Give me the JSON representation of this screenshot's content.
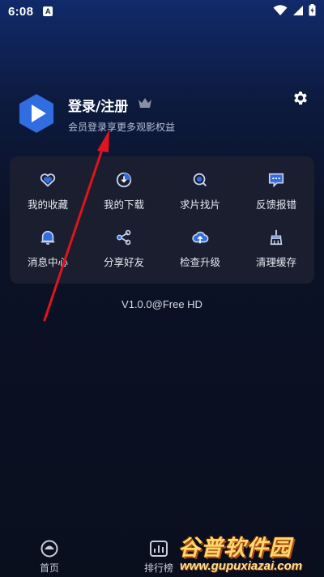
{
  "status_bar": {
    "time": "6:08",
    "notification_letter": "A"
  },
  "profile": {
    "title": "登录/注册",
    "subtitle": "会员登录享更多观影权益",
    "logo_icon": "play-hexagon-icon",
    "crown_icon": "crown-icon",
    "settings_icon": "gear-icon"
  },
  "menu": {
    "items": [
      {
        "label": "我的收藏",
        "icon": "heart-icon"
      },
      {
        "label": "我的下载",
        "icon": "download-icon"
      },
      {
        "label": "求片找片",
        "icon": "search-icon"
      },
      {
        "label": "反馈报错",
        "icon": "feedback-icon"
      },
      {
        "label": "消息中心",
        "icon": "bell-icon"
      },
      {
        "label": "分享好友",
        "icon": "share-icon"
      },
      {
        "label": "检查升级",
        "icon": "upgrade-icon"
      },
      {
        "label": "清理缓存",
        "icon": "broom-icon"
      }
    ]
  },
  "version": "V1.0.0@Free HD",
  "bottom_nav": {
    "items": [
      {
        "label": "首页",
        "icon": "home-icon"
      },
      {
        "label": "排行榜",
        "icon": "rank-icon"
      }
    ]
  },
  "watermark": {
    "text": "谷普软件园",
    "url": "www.gupuxiazai.com"
  },
  "colors": {
    "accent": "#2f6de0",
    "arrow": "#e0141e",
    "card": "#1c2030"
  }
}
